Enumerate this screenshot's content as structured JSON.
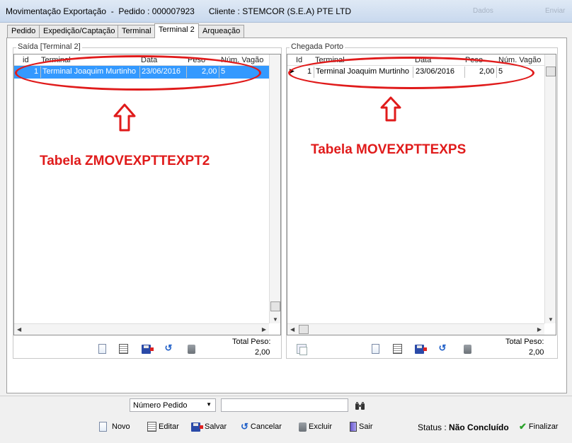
{
  "window": {
    "title": "Movimentação Exportação  -  Pedido : 000007923      Cliente : STEMCOR (S.E.A) PTE LTD",
    "ghost_right_1": "Dados",
    "ghost_right_2": "Enviar"
  },
  "tabs": [
    {
      "label": "Pedido"
    },
    {
      "label": "Expedição/Captação"
    },
    {
      "label": "Terminal"
    },
    {
      "label": "Terminal 2"
    },
    {
      "label": "Arqueação"
    }
  ],
  "left_panel": {
    "legend": "Saída [Terminal 2]",
    "columns": [
      "id",
      "Terminal",
      "Data",
      "Peso",
      "Núm. Vagão"
    ],
    "rows": [
      {
        "id": "1",
        "terminal": "Terminal Joaquim Murtinho",
        "data": "23/06/2016",
        "peso": "2,00",
        "vagao": "5"
      }
    ],
    "total_label": "Total Peso:",
    "total_value": "2,00"
  },
  "right_panel": {
    "legend": "Chegada Porto",
    "columns": [
      "Id",
      "Terminal",
      "Data",
      "Peso",
      "Núm. Vagão"
    ],
    "rows": [
      {
        "id": "1",
        "terminal": "Terminal Joaquim Murtinho",
        "data": "23/06/2016",
        "peso": "2,00",
        "vagao": "5"
      }
    ],
    "total_label": "Total Peso:",
    "total_value": "2,00"
  },
  "annotations": {
    "left": "Tabela ZMOVEXPTTEXPT2",
    "right": "Tabela MOVEXPTTEXPS"
  },
  "search": {
    "field_selected": "Número Pedido",
    "value": ""
  },
  "buttons": {
    "novo": "Novo",
    "editar": "Editar",
    "salvar": "Salvar",
    "cancelar": "Cancelar",
    "excluir": "Excluir",
    "sair": "Sair",
    "finalizar": "Finalizar"
  },
  "status": {
    "label": "Status :",
    "value": "Não Concluído"
  },
  "colors": {
    "annotation": "#e01b1b",
    "selection": "#3399ff"
  }
}
